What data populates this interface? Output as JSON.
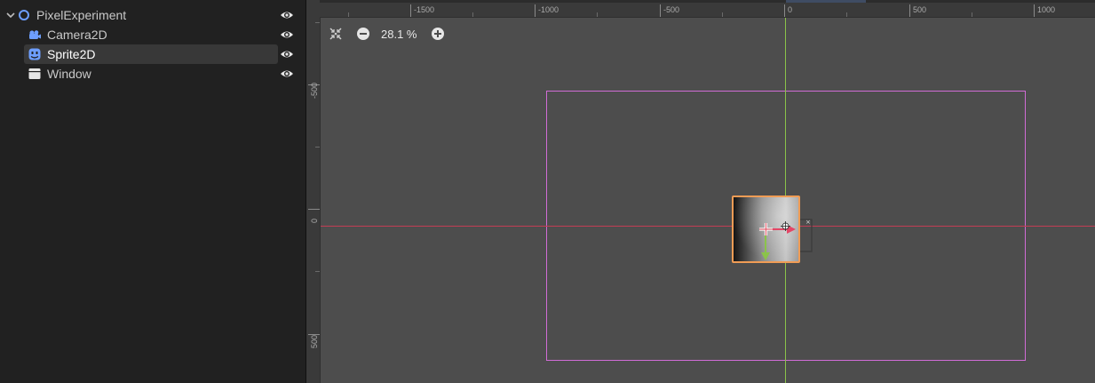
{
  "scene_tree": {
    "nodes": [
      {
        "label": "PixelExperiment",
        "icon": "node-2d-circle-icon",
        "expanded": true,
        "selected": false
      },
      {
        "label": "Camera2D",
        "icon": "camera-2d-icon",
        "selected": false
      },
      {
        "label": "Sprite2D",
        "icon": "sprite-2d-icon",
        "selected": true
      },
      {
        "label": "Window",
        "icon": "window-icon",
        "selected": false
      }
    ],
    "visibility_icon": "eye-icon"
  },
  "ruler": {
    "x_labels": [
      "-1500",
      "-1000",
      "-500",
      "0",
      "500",
      "1000"
    ],
    "y_labels": [
      "-500",
      "0",
      "500"
    ]
  },
  "zoom": {
    "value": "28.1 %",
    "center_icon": "center-view-icon",
    "zoom_out_icon": "zoom-out-icon",
    "zoom_in_icon": "zoom-in-icon"
  },
  "colors": {
    "panel_bg": "#212121",
    "viewport_bg": "#4d4d4d",
    "node_icon_blue": "#6d9eff",
    "x_axis": "#c33d55",
    "y_axis": "#8bc34a",
    "camera_rect": "#d16cd6",
    "selection": "#f09c55"
  }
}
